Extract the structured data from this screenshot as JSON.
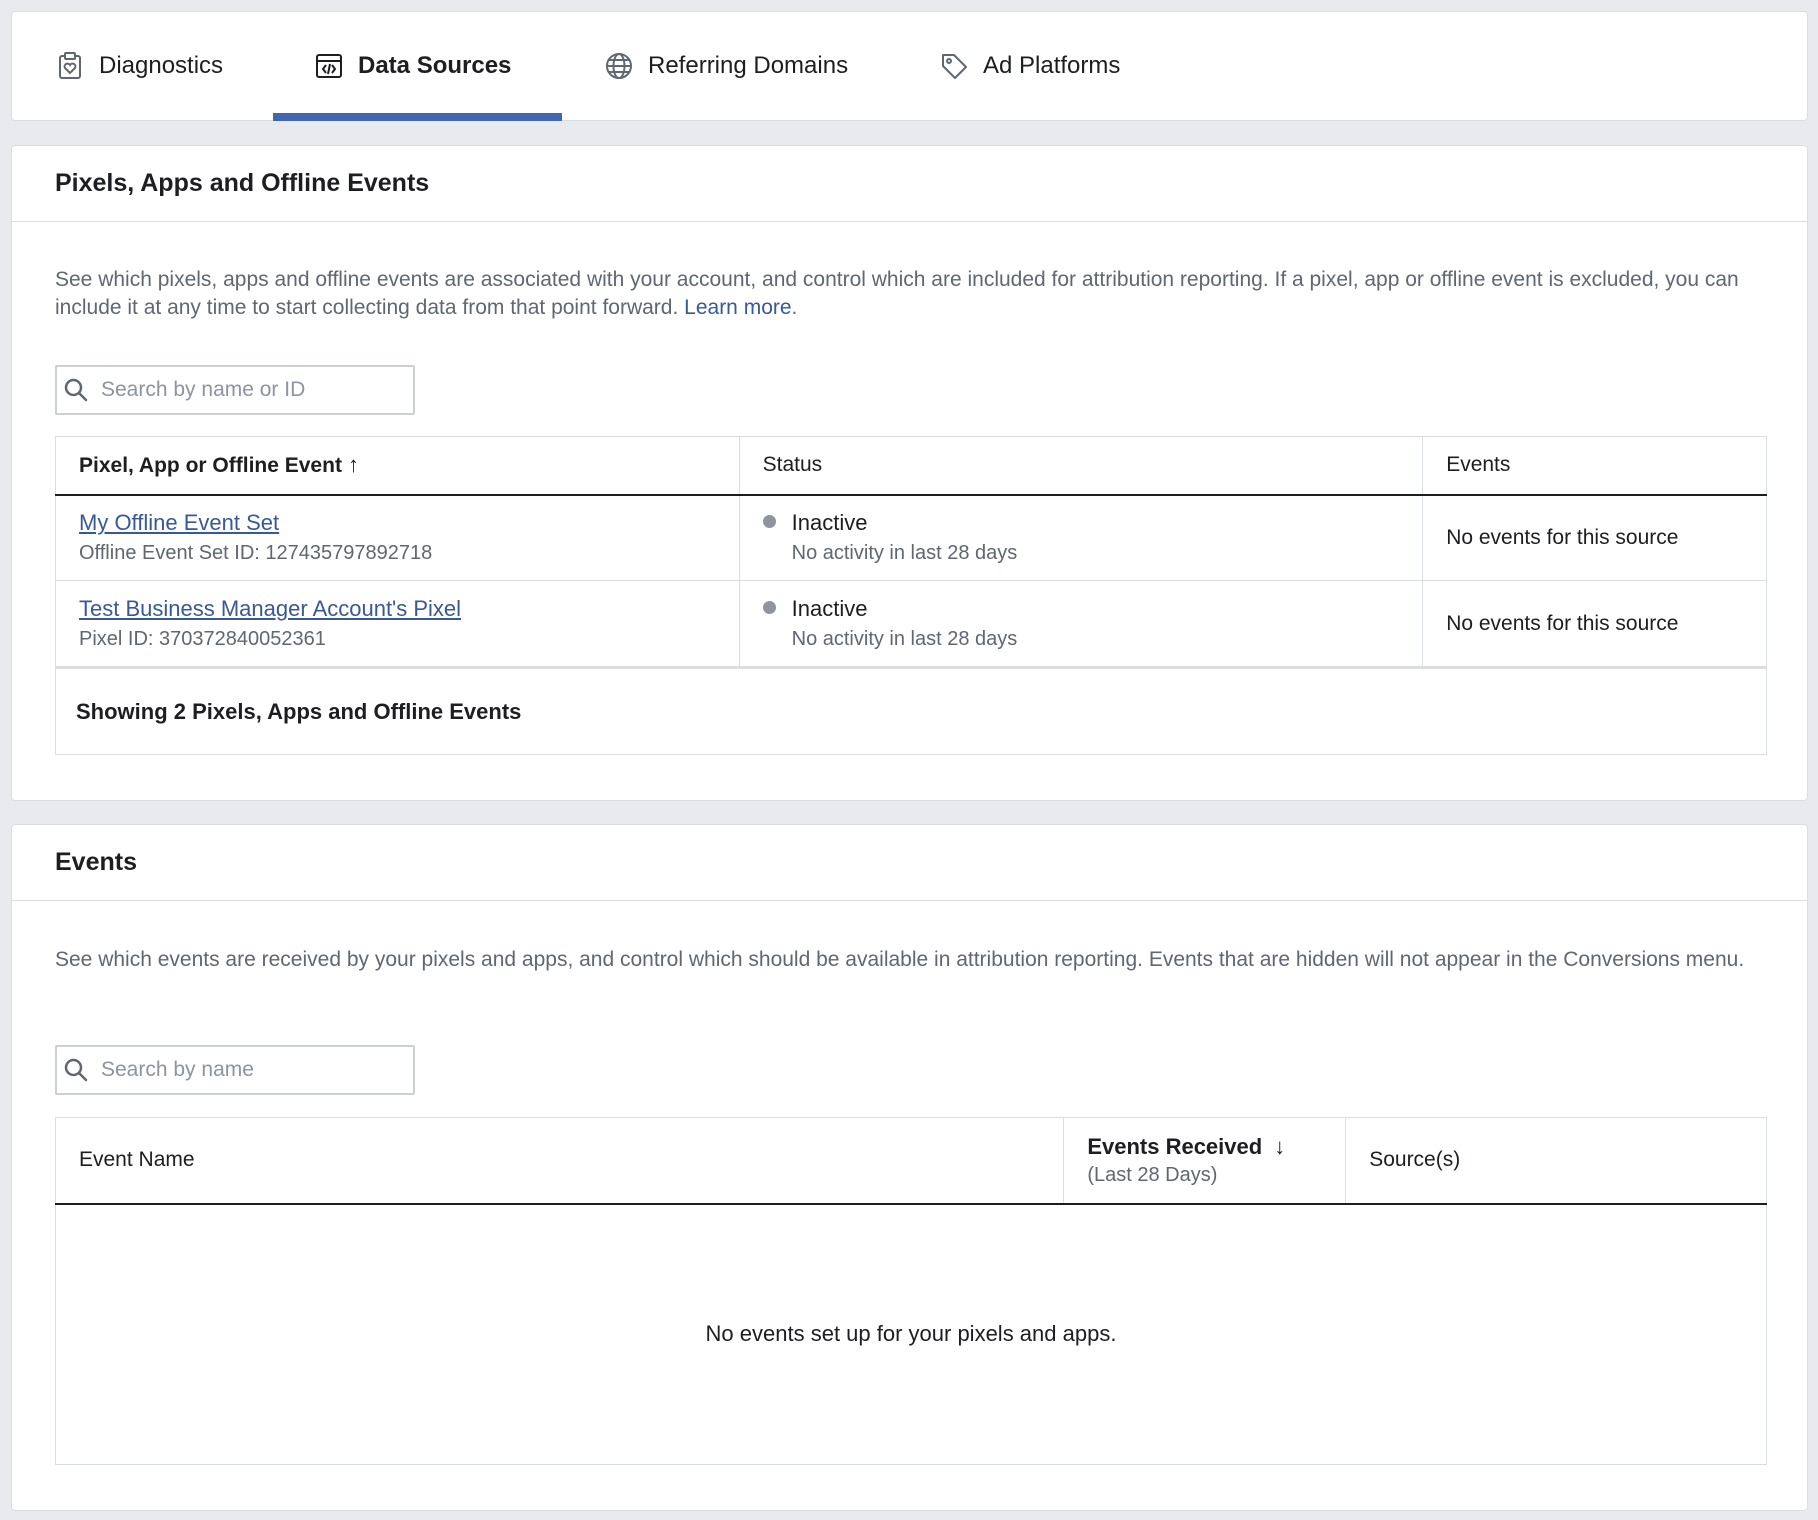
{
  "tabs": [
    {
      "label": "Diagnostics",
      "icon": "clipboard-heart-icon"
    },
    {
      "label": "Data Sources",
      "icon": "code-window-icon",
      "active": true
    },
    {
      "label": "Referring Domains",
      "icon": "globe-icon"
    },
    {
      "label": "Ad Platforms",
      "icon": "tag-icon"
    }
  ],
  "accent_color": "#4267b2",
  "pixels": {
    "title": "Pixels, Apps and Offline Events",
    "description": "See which pixels, apps and offline events are associated with your account, and control which are included for attribution reporting. If a pixel, app or offline event is excluded, you can include it at any time to start collecting data from that point forward.",
    "learn_more": "Learn more",
    "learn_more_suffix": ".",
    "search_placeholder": "Search by name or ID",
    "columns": {
      "name": "Pixel, App or Offline Event",
      "name_sort_icon": "arrow-up-icon",
      "status": "Status",
      "events": "Events"
    },
    "rows": [
      {
        "name": "My Offline Event Set",
        "id_text": "Offline Event Set ID: 127435797892718",
        "status": "Inactive",
        "status_detail": "No activity in last 28 days",
        "events": "No events for this source"
      },
      {
        "name": "Test Business Manager Account's Pixel",
        "id_text": "Pixel ID: 370372840052361",
        "status": "Inactive",
        "status_detail": "No activity in last 28 days",
        "events": "No events for this source"
      }
    ],
    "footer": "Showing 2 Pixels, Apps and Offline Events"
  },
  "events": {
    "title": "Events",
    "description": "See which events are received by your pixels and apps, and control which should be available in attribution reporting. Events that are hidden will not appear in the Conversions menu.",
    "search_placeholder": "Search by name",
    "columns": {
      "name": "Event Name",
      "received": "Events Received",
      "received_sub": "(Last 28 Days)",
      "received_sort_icon": "arrow-down-icon",
      "sources": "Source(s)"
    },
    "empty_message": "No events set up for your pixels and apps."
  }
}
